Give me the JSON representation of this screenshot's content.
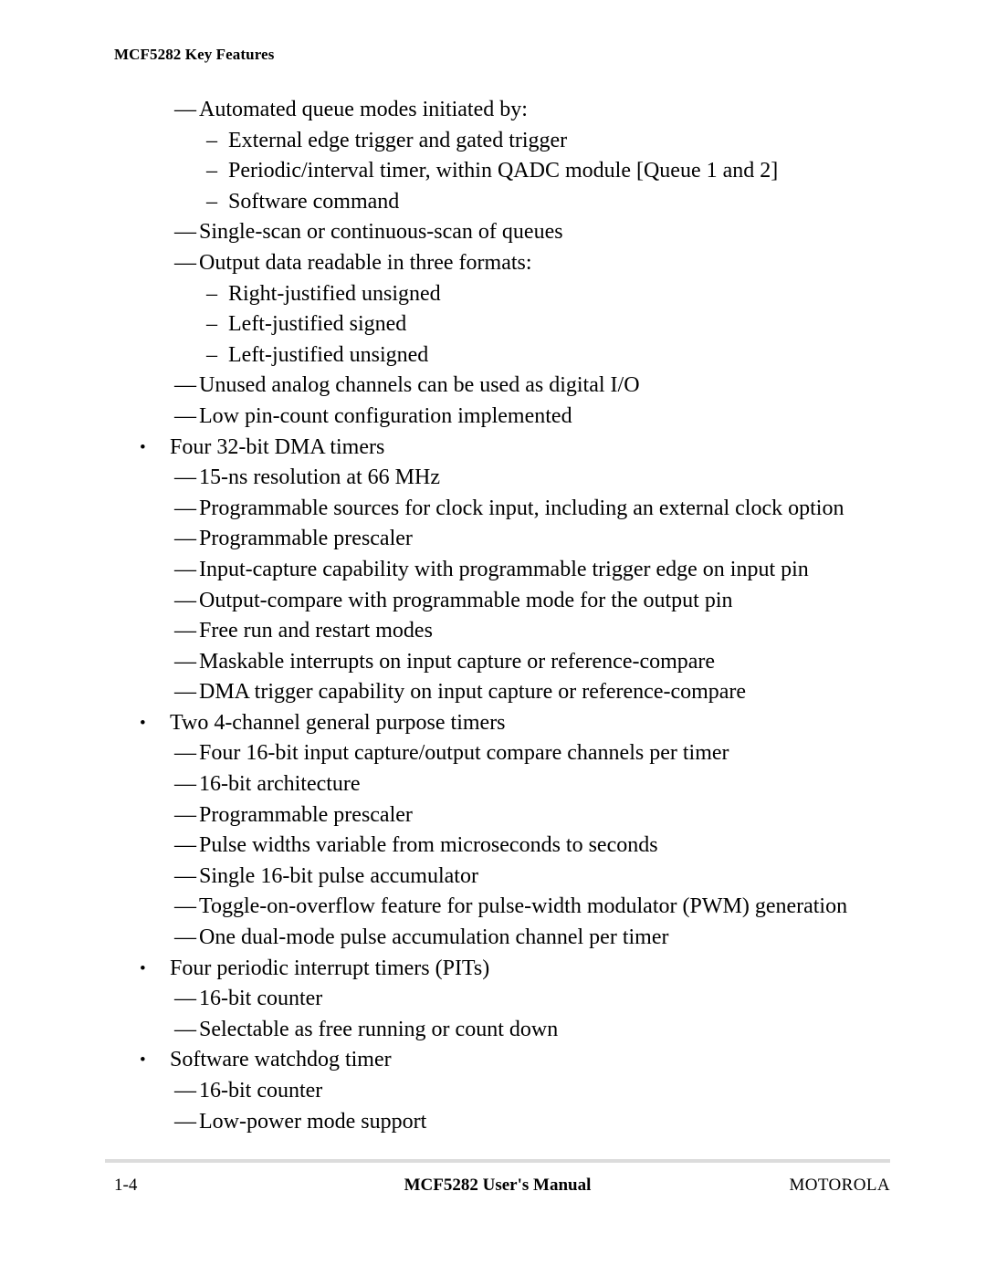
{
  "document": {
    "running_header": "MCF5282 Key Features",
    "markers": {
      "level1": "•",
      "level2": "—",
      "level3": "–"
    },
    "body_items": [
      {
        "level": 2,
        "text": "Automated queue modes initiated by:"
      },
      {
        "level": 3,
        "text": "External edge trigger and gated trigger"
      },
      {
        "level": 3,
        "text": "Periodic/interval timer, within QADC module [Queue 1 and 2]"
      },
      {
        "level": 3,
        "text": "Software command"
      },
      {
        "level": 2,
        "text": "Single-scan or continuous-scan of queues"
      },
      {
        "level": 2,
        "text": "Output data readable in three formats:"
      },
      {
        "level": 3,
        "text": "Right-justified unsigned"
      },
      {
        "level": 3,
        "text": "Left-justified signed"
      },
      {
        "level": 3,
        "text": "Left-justified unsigned"
      },
      {
        "level": 2,
        "text": "Unused analog channels can be used as digital I/O"
      },
      {
        "level": 2,
        "text": "Low pin-count configuration implemented"
      },
      {
        "level": 1,
        "text": "Four 32-bit DMA timers"
      },
      {
        "level": 2,
        "text": "15-ns resolution at 66 MHz"
      },
      {
        "level": 2,
        "text": "Programmable sources for clock input, including an external clock option"
      },
      {
        "level": 2,
        "text": "Programmable prescaler"
      },
      {
        "level": 2,
        "text": "Input-capture capability with programmable trigger edge on input pin"
      },
      {
        "level": 2,
        "text": "Output-compare with programmable mode for the output pin"
      },
      {
        "level": 2,
        "text": "Free run and restart modes"
      },
      {
        "level": 2,
        "text": "Maskable interrupts on input capture or reference-compare"
      },
      {
        "level": 2,
        "text": "DMA trigger capability on input capture or reference-compare"
      },
      {
        "level": 1,
        "text": "Two 4-channel general purpose timers"
      },
      {
        "level": 2,
        "text": "Four 16-bit input capture/output compare channels per timer"
      },
      {
        "level": 2,
        "text": "16-bit architecture"
      },
      {
        "level": 2,
        "text": "Programmable prescaler"
      },
      {
        "level": 2,
        "text": "Pulse widths variable from microseconds to seconds"
      },
      {
        "level": 2,
        "text": "Single 16-bit pulse accumulator"
      },
      {
        "level": 2,
        "text": "Toggle-on-overflow feature for pulse-width modulator (PWM) generation"
      },
      {
        "level": 2,
        "text": "One dual-mode pulse accumulation channel per timer"
      },
      {
        "level": 1,
        "text": "Four periodic interrupt timers (PITs)"
      },
      {
        "level": 2,
        "text": "16-bit counter"
      },
      {
        "level": 2,
        "text": "Selectable as free running or count down"
      },
      {
        "level": 1,
        "text": "Software watchdog timer"
      },
      {
        "level": 2,
        "text": "16-bit counter"
      },
      {
        "level": 2,
        "text": "Low-power mode support"
      }
    ],
    "footer": {
      "page_number": "1-4",
      "manual_title": "MCF5282 User's Manual",
      "publisher": "MOTOROLA"
    },
    "colors": {
      "text": "#000000",
      "page_background": "#ffffff",
      "footer_rule": "#dcdcdc"
    }
  }
}
